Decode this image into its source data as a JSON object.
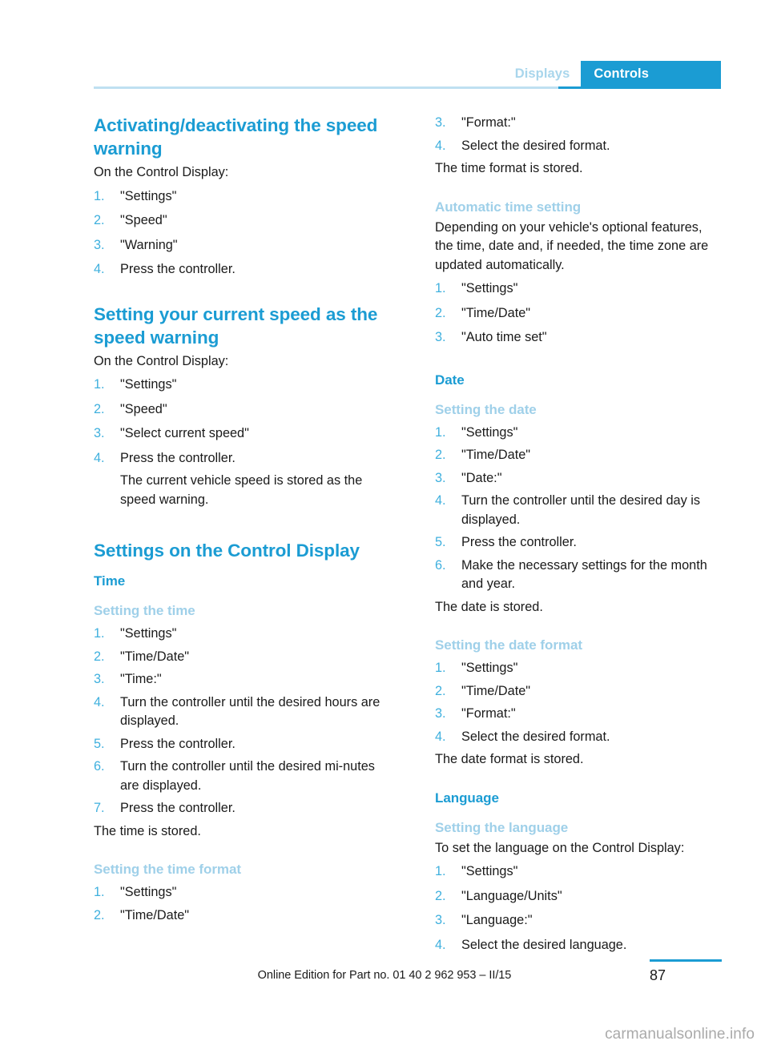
{
  "header": {
    "tab_inactive": "Displays",
    "tab_active": "Controls",
    "accent_color": "#1b9cd3",
    "accent_light_color": "#9fd0e9",
    "rule_color": "#bfe0f1"
  },
  "left_column": {
    "section_1": {
      "heading": "Activating/deactivating the speed warning",
      "intro": "On the Control Display:",
      "steps": [
        {
          "num": "1.",
          "text": "\"Settings\""
        },
        {
          "num": "2.",
          "text": "\"Speed\""
        },
        {
          "num": "3.",
          "text": "\"Warning\""
        },
        {
          "num": "4.",
          "text": "Press the controller."
        }
      ]
    },
    "section_2": {
      "heading": "Setting your current speed as the speed warning",
      "intro": "On the Control Display:",
      "steps": [
        {
          "num": "1.",
          "text": "\"Settings\""
        },
        {
          "num": "2.",
          "text": "\"Speed\""
        },
        {
          "num": "3.",
          "text": "\"Select current speed\""
        },
        {
          "num": "4.",
          "text": "Press the controller.",
          "sub": "The current vehicle speed is stored as the speed warning."
        }
      ]
    },
    "section_3": {
      "heading": "Settings on the Control Display",
      "sub_heading": "Time",
      "light_heading": "Setting the time",
      "steps": [
        {
          "num": "1.",
          "text": "\"Settings\""
        },
        {
          "num": "2.",
          "text": "\"Time/Date\""
        },
        {
          "num": "3.",
          "text": "\"Time:\""
        },
        {
          "num": "4.",
          "text": "Turn the controller until the desired hours are displayed."
        },
        {
          "num": "5.",
          "text": "Press the controller."
        },
        {
          "num": "6.",
          "text": "Turn the controller until the desired mi-nutes are displayed."
        },
        {
          "num": "7.",
          "text": "Press the controller."
        }
      ],
      "closing": "The time is stored."
    },
    "section_4": {
      "light_heading": "Setting the time format",
      "steps": [
        {
          "num": "1.",
          "text": "\"Settings\""
        },
        {
          "num": "2.",
          "text": "\"Time/Date\""
        }
      ]
    }
  },
  "right_column": {
    "section_1": {
      "steps": [
        {
          "num": "3.",
          "text": "\"Format:\""
        },
        {
          "num": "4.",
          "text": "Select the desired format."
        }
      ],
      "closing": "The time format is stored."
    },
    "section_2": {
      "light_heading": "Automatic time setting",
      "intro": "Depending on your vehicle's optional features, the time, date and, if needed, the time zone are updated automatically.",
      "steps": [
        {
          "num": "1.",
          "text": "\"Settings\""
        },
        {
          "num": "2.",
          "text": "\"Time/Date\""
        },
        {
          "num": "3.",
          "text": "\"Auto time set\""
        }
      ]
    },
    "section_3": {
      "sub_heading": "Date",
      "light_heading": "Setting the date",
      "steps": [
        {
          "num": "1.",
          "text": "\"Settings\""
        },
        {
          "num": "2.",
          "text": "\"Time/Date\""
        },
        {
          "num": "3.",
          "text": "\"Date:\""
        },
        {
          "num": "4.",
          "text": "Turn the controller until the desired day is displayed."
        },
        {
          "num": "5.",
          "text": "Press the controller."
        },
        {
          "num": "6.",
          "text": "Make the necessary settings for the month and year."
        }
      ],
      "closing": "The date is stored."
    },
    "section_4": {
      "light_heading": "Setting the date format",
      "steps": [
        {
          "num": "1.",
          "text": "\"Settings\""
        },
        {
          "num": "2.",
          "text": "\"Time/Date\""
        },
        {
          "num": "3.",
          "text": "\"Format:\""
        },
        {
          "num": "4.",
          "text": "Select the desired format."
        }
      ],
      "closing": "The date format is stored."
    },
    "section_5": {
      "sub_heading": "Language",
      "light_heading": "Setting the language",
      "intro": "To set the language on the Control Display:",
      "steps": [
        {
          "num": "1.",
          "text": "\"Settings\""
        },
        {
          "num": "2.",
          "text": "\"Language/Units\""
        },
        {
          "num": "3.",
          "text": "\"Language:\""
        },
        {
          "num": "4.",
          "text": "Select the desired language."
        }
      ]
    }
  },
  "footer": {
    "edition_text": "Online Edition for Part no. 01 40 2 962 953 – II/15",
    "page_number": "87"
  },
  "watermark": {
    "text": "carmanualsonline.info"
  }
}
